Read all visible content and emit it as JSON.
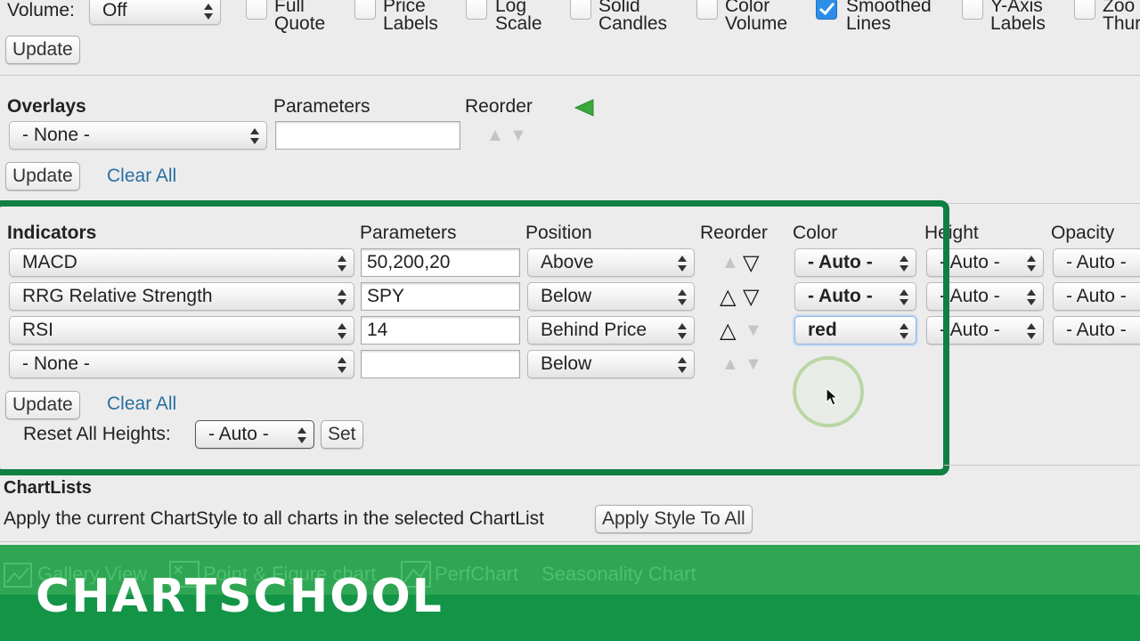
{
  "top_row": {
    "volume_label": "Volume:",
    "volume_value": "Off",
    "checkboxes": [
      {
        "line1": "Full",
        "line2": "Quote",
        "checked": false
      },
      {
        "line1": "Price",
        "line2": "Labels",
        "checked": false
      },
      {
        "line1": "Log",
        "line2": "Scale",
        "checked": false
      },
      {
        "line1": "Solid",
        "line2": "Candles",
        "checked": false
      },
      {
        "line1": "Color",
        "line2": "Volume",
        "checked": false
      },
      {
        "line1": "Smoothed",
        "line2": "Lines",
        "checked": true
      },
      {
        "line1": "Y-Axis",
        "line2": "Labels",
        "checked": false
      },
      {
        "line1": "Zoo",
        "line2": "Thur",
        "checked": false
      }
    ],
    "update_label": "Update"
  },
  "overlays": {
    "heading": "Overlays",
    "params_heading": "Parameters",
    "reorder_heading": "Reorder",
    "select_value": "- None -",
    "param_value": "",
    "update_label": "Update",
    "clear_label": "Clear All"
  },
  "indicators": {
    "heading": "Indicators",
    "params_heading": "Parameters",
    "position_heading": "Position",
    "reorder_heading": "Reorder",
    "color_heading": "Color",
    "height_heading": "Height",
    "opacity_heading": "Opacity",
    "rows": [
      {
        "name": "MACD",
        "params": "50,200,20",
        "position": "Above",
        "color": "- Auto -",
        "height": "- Auto -",
        "opacity": "- Auto -"
      },
      {
        "name": "RRG Relative Strength",
        "params": "SPY",
        "position": "Below",
        "color": "- Auto -",
        "height": "- Auto -",
        "opacity": "- Auto -"
      },
      {
        "name": "RSI",
        "params": "14",
        "position": "Behind Price",
        "color": "red",
        "height": "- Auto -",
        "opacity": "- Auto -"
      },
      {
        "name": "- None -",
        "params": "",
        "position": "Below"
      }
    ],
    "update_label": "Update",
    "clear_label": "Clear All",
    "reset_label": "Reset All Heights:",
    "reset_value": "- Auto -",
    "set_label": "Set"
  },
  "chartlists": {
    "heading": "ChartLists",
    "description": "Apply the current ChartStyle to all charts in the selected ChartList",
    "apply_label": "Apply Style To All"
  },
  "footer": {
    "links": [
      "Gallery View",
      "Point & Figure chart",
      "PerfChart",
      "Seasonality Chart"
    ],
    "brand": "CHARTSCHOOL"
  },
  "colors": {
    "highlight_border": "#0f7f42",
    "link": "#2a6fa0",
    "footer_green": "#2fa653",
    "footer_dark": "#139447",
    "checkbox_checked": "#2c8ee8",
    "reorder_arrow": "#3aa83a"
  }
}
